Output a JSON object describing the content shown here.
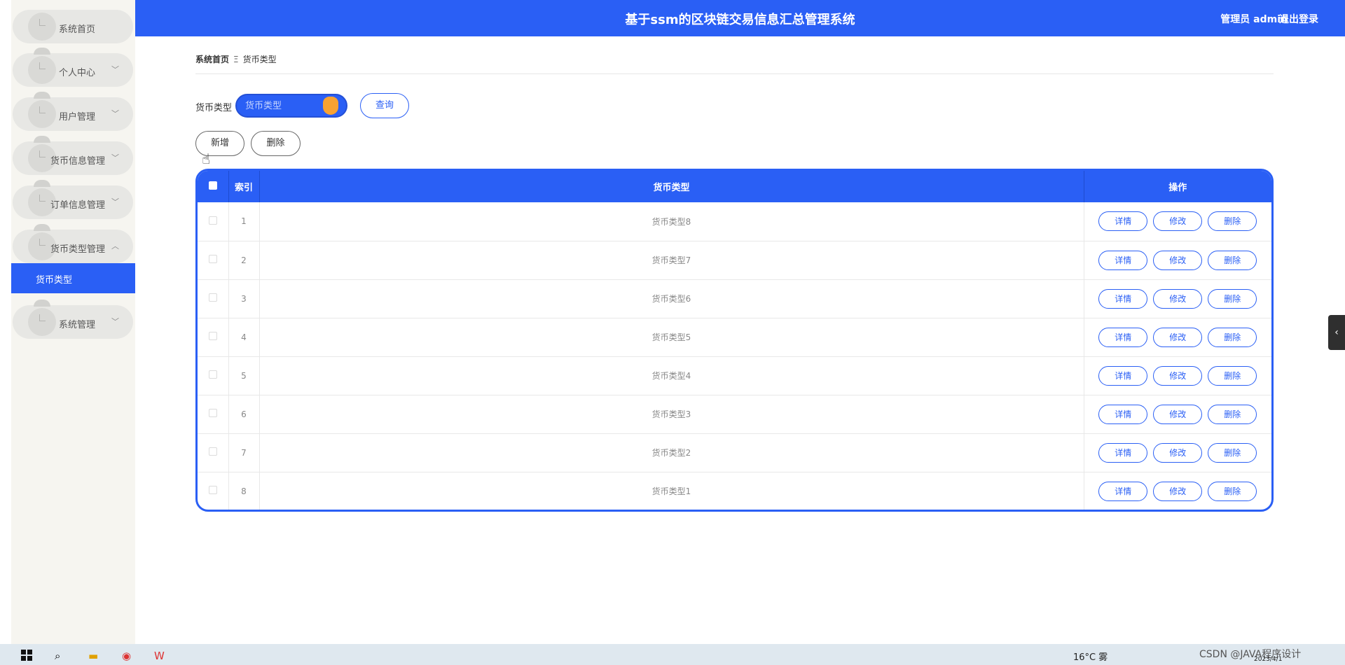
{
  "sidebar": {
    "items": [
      {
        "label": "系统首页",
        "chevron": ""
      },
      {
        "label": "个人中心",
        "chevron": "﹀"
      },
      {
        "label": "用户管理",
        "chevron": "﹀"
      },
      {
        "label": "货币信息管理",
        "chevron": "﹀"
      },
      {
        "label": "订单信息管理",
        "chevron": "﹀"
      },
      {
        "label": "货币类型管理",
        "chevron": "︿"
      },
      {
        "label": "系统管理",
        "chevron": "﹀"
      }
    ],
    "active_sub": "货币类型"
  },
  "header": {
    "title": "基于ssm的区块链交易信息汇总管理系统",
    "user": "管理员 admin",
    "logout": "退出登录"
  },
  "breadcrumb": {
    "home": "系统首页",
    "separator": "Ξ",
    "current": "货币类型"
  },
  "search": {
    "label": "货币类型",
    "placeholder": "货币类型",
    "query_button": "查询"
  },
  "actions": {
    "add": "新增",
    "delete": "删除"
  },
  "table": {
    "columns": [
      "",
      "索引",
      "货币类型",
      "操作"
    ],
    "rows": [
      {
        "index": "1",
        "name": "货币类型8"
      },
      {
        "index": "2",
        "name": "货币类型7"
      },
      {
        "index": "3",
        "name": "货币类型6"
      },
      {
        "index": "4",
        "name": "货币类型5"
      },
      {
        "index": "5",
        "name": "货币类型4"
      },
      {
        "index": "6",
        "name": "货币类型3"
      },
      {
        "index": "7",
        "name": "货币类型2"
      },
      {
        "index": "8",
        "name": "货币类型1"
      }
    ],
    "row_actions": {
      "detail": "详情",
      "edit": "修改",
      "delete": "删除"
    }
  },
  "taskbar": {
    "weather": "16°C 雾",
    "watermark": "CSDN @JAVA程序设计",
    "date": "2023/4/1"
  },
  "colors": {
    "primary": "#2a5ff5",
    "accent_knob": "#f8a232"
  }
}
